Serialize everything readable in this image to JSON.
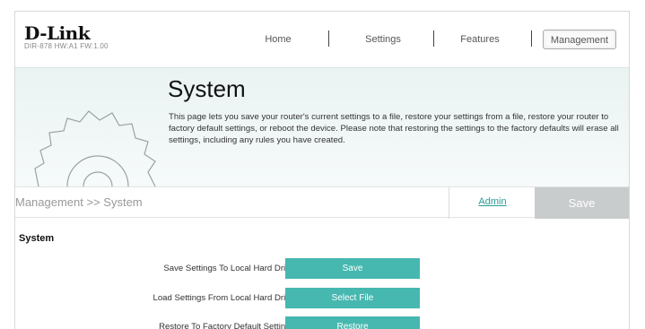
{
  "brand": {
    "logo_text": "D-Link",
    "model_info": "DIR-878 HW:A1 FW:1.00"
  },
  "nav": {
    "items": [
      {
        "label": "Home",
        "active": false
      },
      {
        "label": "Settings",
        "active": false
      },
      {
        "label": "Features",
        "active": false
      },
      {
        "label": "Management",
        "active": true
      }
    ]
  },
  "hero": {
    "icon": "gear-icon",
    "title": "System",
    "description": "This page lets you save your router's current settings to a file, restore your settings from a file, restore your router to factory default settings, or reboot the device. Please note that restoring the settings to the factory defaults will erase all settings, including any rules you have created."
  },
  "toolbar": {
    "breadcrumb": "Management >> System",
    "admin_link": "Admin",
    "save_label": "Save"
  },
  "section": {
    "title": "System",
    "rows": [
      {
        "label": "Save Settings To Local Hard Drive:",
        "button": "Save"
      },
      {
        "label": "Load Settings From Local Hard Drive:",
        "button": "Select File"
      },
      {
        "label": "Restore To Factory Default Settings:",
        "button": "Restore"
      }
    ]
  },
  "colors": {
    "accent": "#46b8b0",
    "link": "#2a9d96",
    "save_disabled": "#c9cccd",
    "hero_bg": "#eaf3f2"
  }
}
